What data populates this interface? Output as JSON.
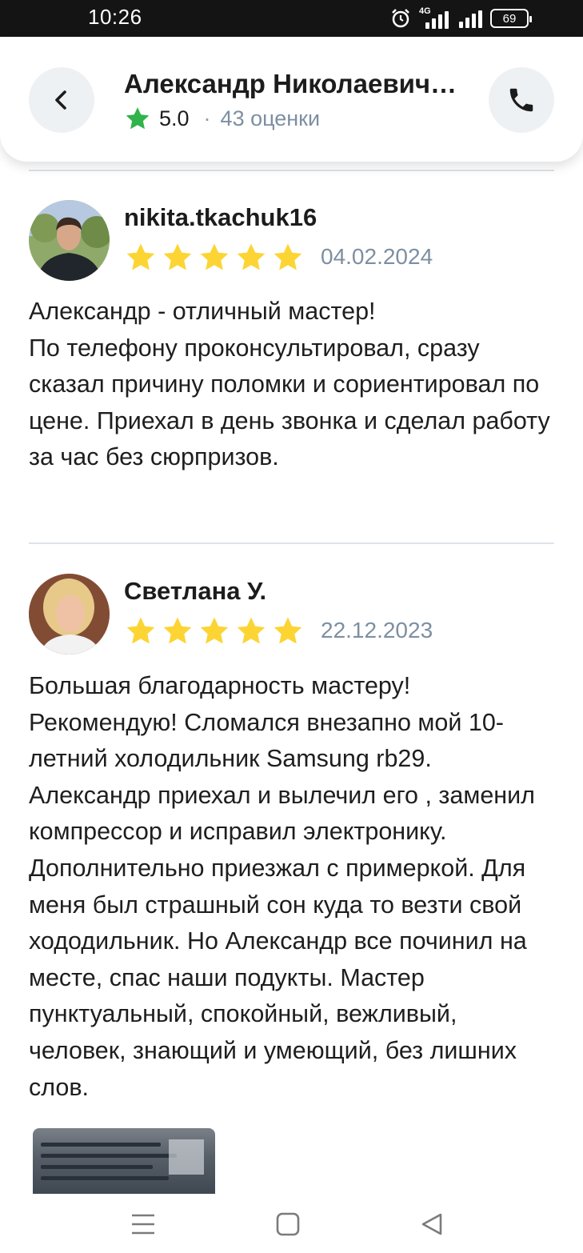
{
  "status_bar": {
    "time": "10:26",
    "network": "4G",
    "battery": "69",
    "icons": [
      "alarm-icon",
      "signal-icon",
      "battery-icon"
    ]
  },
  "header": {
    "title": "Александр Николаевич…",
    "rating": "5.0",
    "separator": "·",
    "ratings_count": "43 оценки",
    "back_icon": "chevron-left-icon",
    "call_icon": "phone-icon",
    "star_color": "#2fb34a"
  },
  "reviews": [
    {
      "author": "nikita.tkachuk16",
      "stars": 5,
      "date": "04.02.2024",
      "text": "Александр - отличный мастер!\nПо телефону проконсультировал, сразу сказал причину поломки и сориентировал по цене. Приехал в день звонка и сделал работу за час без сюрпризов."
    },
    {
      "author": "Светлана У.",
      "stars": 5,
      "date": "22.12.2023",
      "text": "Большая благодарность мастеру! Рекомендую! Сломался внезапно мой 10- летний холодильник Samsung rb29. Александр приехал и вылечил его , заменил компрессор и исправил электронику. Дополнительно приезжал с примеркой. Для меня был страшный сон куда то везти свой хододильник. Но Александр все починил на месте, спас наши подукты. Мастер пунктуальный, спокойный, вежливый, человек, знающий и умеющий, без лишних слов."
    }
  ],
  "colors": {
    "review_star": "#fcd535",
    "muted_text": "#7d8fa1",
    "divider": "#dde3e8"
  },
  "nav_bar": {
    "icons": [
      "menu-icon",
      "home-square-icon",
      "back-triangle-icon"
    ]
  }
}
